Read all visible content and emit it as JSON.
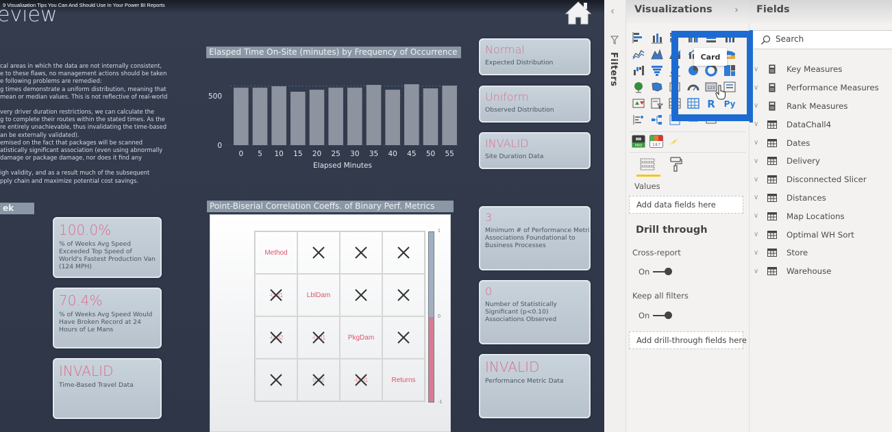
{
  "video_title": "9 Visualization Tips You Can And Should Use In Your Power BI Reports",
  "report": {
    "page_heading": "eview",
    "narrative": [
      "cal areas in which the data are not internally consistent,",
      "e to these flaws, no management actions should be taken",
      "e following problems are remedied:",
      "g times demonstrate a uniform distribution, meaning that",
      " mean or median values. This is not reflective of real-world",
      "",
      "very driver duration restrictions, we can calculate the",
      "g to complete their routes within the stated times. As the",
      "re entirely unachievable, thus invalidating the time-based",
      "an be externally validated).",
      "emised on the fact that packages will be scanned",
      "atistically significant association (even using abnormally",
      " damage or package damage, nor does it find any",
      "",
      "igh validity, and as a result much of the subsequent",
      "pply chain and maximize potential cost savings."
    ],
    "week_section_label": "ek",
    "left_cards": [
      {
        "value": "100.0%",
        "caption": "% of Weeks Avg Speed Exceeded Top Speed of World's Fastest Production Van (124 MPH)"
      },
      {
        "value": "70.4%",
        "caption": "% of Weeks Avg Speed Would Have Broken Record at 24 Hours of Le Mans"
      },
      {
        "value": "INVALID",
        "caption": "Time-Based Travel Data"
      }
    ],
    "distribution_cards": [
      {
        "value": "Normal",
        "caption": "Expected Distribution"
      },
      {
        "value": "Uniform",
        "caption": "Observed Distribution"
      },
      {
        "value": "INVALID",
        "caption": "Site Duration Data"
      }
    ],
    "performance_cards": [
      {
        "value": "3",
        "caption": "Minimum # of Performance Metric Associations Foundational to Business Processes"
      },
      {
        "value": "0",
        "caption": "Number of Statistically Significant (p<0.10) Associations Observed"
      },
      {
        "value": "INVALID",
        "caption": "Performance Metric Data"
      }
    ],
    "correlation": {
      "title": "Point-Biserial Correlation Coeffs. of Binary Perf. Metrics",
      "metrics": [
        "Method",
        "LblDam",
        "PkgDam",
        "Returns"
      ],
      "lower_values": [
        [
          "",
          "",
          "",
          ""
        ],
        [
          "-0.01",
          "",
          "",
          ""
        ],
        [
          "-0.02",
          "-0.01",
          "",
          ""
        ],
        [
          "",
          "0.02",
          "-0.01",
          ""
        ]
      ],
      "colorbar_ticks": [
        "1",
        "0",
        "-1"
      ],
      "colors": {
        "positive": "#9fb0c2",
        "negative": "#d87b92",
        "label": "#e0556b"
      }
    }
  },
  "chart_data": {
    "type": "bar",
    "title": "Elasped Time On-Site (minutes) by Frequency of Occurrence",
    "xlabel": "Elapsed Minutes",
    "ylabel": "",
    "categories": [
      "0",
      "5",
      "10",
      "15",
      "20",
      "25",
      "30",
      "35",
      "40",
      "45",
      "50",
      "55"
    ],
    "values": [
      583,
      583,
      597,
      542,
      562,
      583,
      583,
      611,
      562,
      618,
      576,
      604
    ],
    "ylim": [
      0,
      750
    ],
    "yticks": [
      0,
      500
    ],
    "grid": true,
    "bar_color": "#8e93a0"
  },
  "filters_pane": {
    "label": "Filters",
    "collapse_icon": "chevron-left-icon",
    "filter_icon": "funnel-icon"
  },
  "visualizations_pane": {
    "title": "Visualizations",
    "tooltip": "Card",
    "visual_icons": [
      "stacked-bar-icon",
      "stacked-column-icon",
      "clustered-bar-icon",
      "clustered-column-icon",
      "100-stacked-bar-icon",
      "100-stacked-column-icon",
      "line-chart-icon",
      "area-chart-icon",
      "stacked-area-icon",
      "line-clustered-column-icon",
      "line-stacked-column-icon",
      "ribbon-chart-icon",
      "waterfall-icon",
      "funnel-icon",
      "scatter-icon",
      "pie-chart-icon",
      "donut-chart-icon",
      "treemap-icon",
      "map-icon",
      "filled-map-icon",
      "shape-map-icon",
      "gauge-icon",
      "card-icon",
      "multi-row-card-icon",
      "kpi-icon",
      "slicer-icon",
      "table-icon",
      "matrix-icon",
      "r-visual-icon",
      "python-visual-icon",
      "key-influencers-icon",
      "decomposition-tree-icon",
      "qa-icon",
      "smart-narrative-icon",
      "paginated-icon",
      "more-icon"
    ],
    "custom_visual_icons": [
      "pro-visual-icon",
      "score-visual-icon",
      "bolt-visual-icon"
    ],
    "tabs": {
      "fields": "fields-tab",
      "format": "format-tab"
    },
    "values_label": "Values",
    "values_placeholder": "Add data fields here",
    "drill_through": {
      "title": "Drill through",
      "cross_report_label": "Cross-report",
      "cross_report_state": "On",
      "keep_filters_label": "Keep all filters",
      "keep_filters_state": "On",
      "drop_placeholder": "Add drill-through fields here"
    },
    "accent": "#1d6bd1"
  },
  "fields_pane": {
    "title": "Fields",
    "search_placeholder": "Search",
    "items": [
      {
        "label": "Key Measures",
        "icon": "calculator-icon"
      },
      {
        "label": "Performance Measures",
        "icon": "calculator-icon"
      },
      {
        "label": "Rank Measures",
        "icon": "calculator-icon"
      },
      {
        "label": "DataChall4",
        "icon": "table-icon"
      },
      {
        "label": "Dates",
        "icon": "table-icon"
      },
      {
        "label": "Delivery",
        "icon": "table-icon"
      },
      {
        "label": "Disconnected Slicer",
        "icon": "table-icon"
      },
      {
        "label": "Distances",
        "icon": "table-icon"
      },
      {
        "label": "Map Locations",
        "icon": "table-icon"
      },
      {
        "label": "Optimal WH Sort",
        "icon": "table-icon"
      },
      {
        "label": "Store",
        "icon": "table-icon"
      },
      {
        "label": "Warehouse",
        "icon": "table-icon"
      }
    ]
  }
}
